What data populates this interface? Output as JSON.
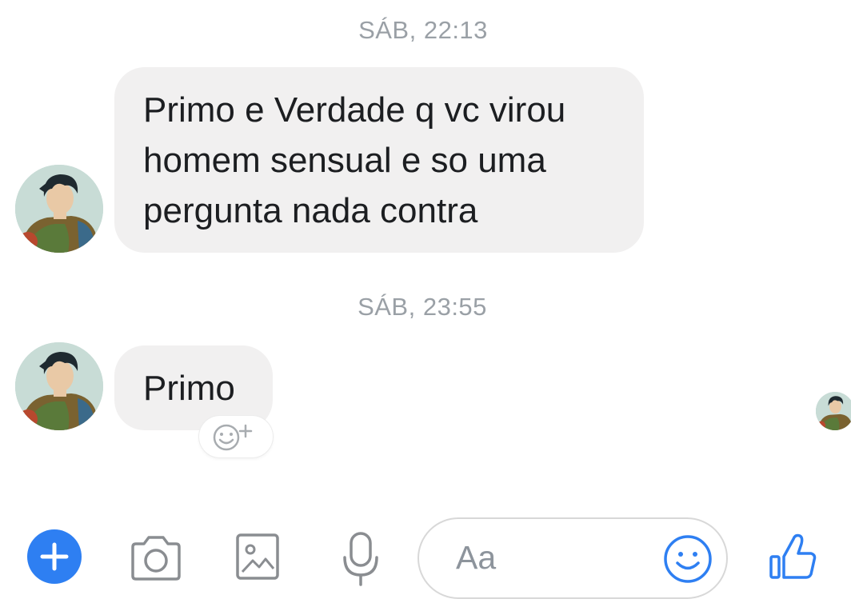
{
  "conversation": {
    "groups": [
      {
        "timestamp": "SÁB, 22:13",
        "message_lines": [
          "Primo e Verdade q vc virou",
          "homem sensual e so uma",
          "pergunta nada contra"
        ]
      },
      {
        "timestamp": "SÁB, 23:55",
        "message_lines": [
          "Primo"
        ]
      }
    ]
  },
  "composer": {
    "input_placeholder": "Aa",
    "icons": [
      "plus-icon",
      "camera-icon",
      "gallery-icon",
      "microphone-icon",
      "emoji-icon",
      "thumbs-up-icon"
    ]
  },
  "colors": {
    "accent": "#2e7ff2",
    "bubble": "#f1f0f0",
    "timestamp": "#9aa0a6",
    "icon": "#8a8d91"
  }
}
